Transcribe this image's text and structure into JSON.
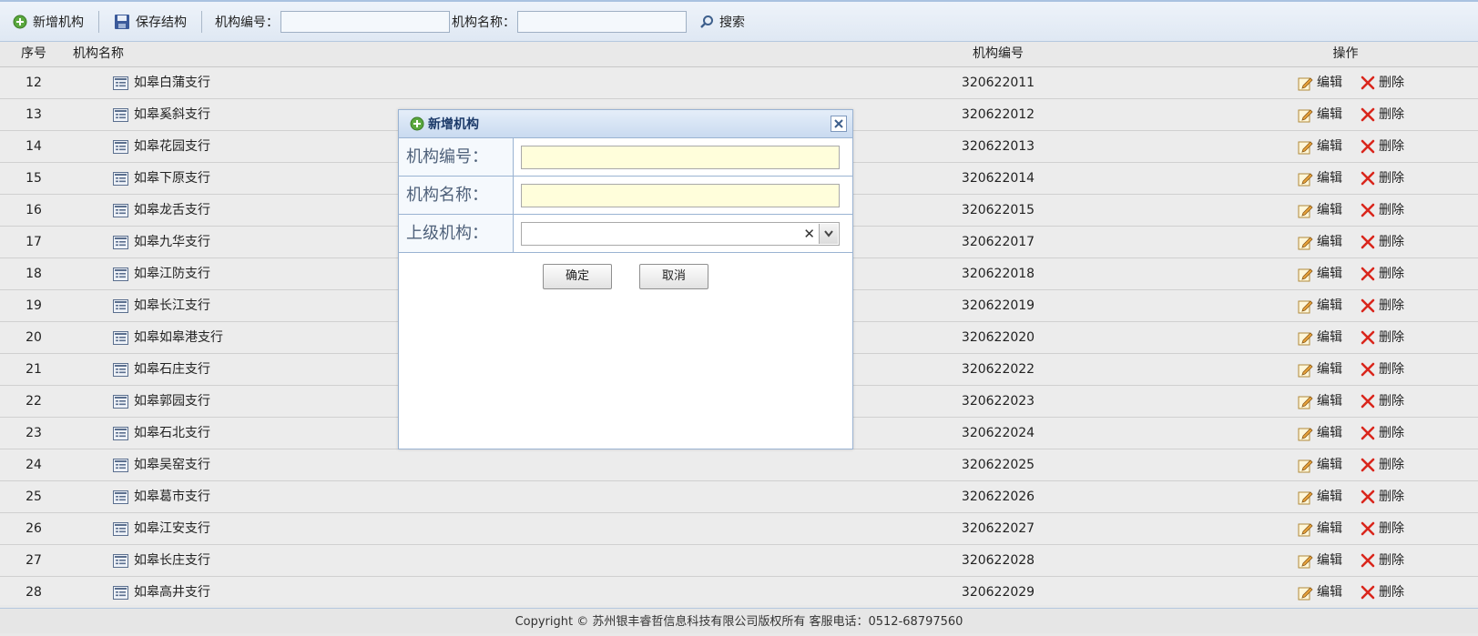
{
  "toolbar": {
    "add_label": "新增机构",
    "save_label": "保存结构",
    "code_label": "机构编号：",
    "name_label": "机构名称：",
    "code_value": "",
    "name_value": "",
    "search_label": "搜索"
  },
  "table": {
    "headers": {
      "index": "序号",
      "name": "机构名称",
      "code": "机构编号",
      "ops": "操作"
    },
    "edit_label": "编辑",
    "delete_label": "删除",
    "rows": [
      {
        "index": "12",
        "name": "如皋白蒲支行",
        "code": "320622011"
      },
      {
        "index": "13",
        "name": "如皋奚斜支行",
        "code": "320622012"
      },
      {
        "index": "14",
        "name": "如皋花园支行",
        "code": "320622013"
      },
      {
        "index": "15",
        "name": "如皋下原支行",
        "code": "320622014"
      },
      {
        "index": "16",
        "name": "如皋龙舌支行",
        "code": "320622015"
      },
      {
        "index": "17",
        "name": "如皋九华支行",
        "code": "320622017"
      },
      {
        "index": "18",
        "name": "如皋江防支行",
        "code": "320622018"
      },
      {
        "index": "19",
        "name": "如皋长江支行",
        "code": "320622019"
      },
      {
        "index": "20",
        "name": "如皋如皋港支行",
        "code": "320622020"
      },
      {
        "index": "21",
        "name": "如皋石庄支行",
        "code": "320622022"
      },
      {
        "index": "22",
        "name": "如皋郭园支行",
        "code": "320622023"
      },
      {
        "index": "23",
        "name": "如皋石北支行",
        "code": "320622024"
      },
      {
        "index": "24",
        "name": "如皋吴窑支行",
        "code": "320622025"
      },
      {
        "index": "25",
        "name": "如皋葛市支行",
        "code": "320622026"
      },
      {
        "index": "26",
        "name": "如皋江安支行",
        "code": "320622027"
      },
      {
        "index": "27",
        "name": "如皋长庄支行",
        "code": "320622028"
      },
      {
        "index": "28",
        "name": "如皋高井支行",
        "code": "320622029"
      }
    ]
  },
  "footer": {
    "text": "Copyright © 苏州银丰睿哲信息科技有限公司版权所有    客服电话：0512-68797560"
  },
  "dialog": {
    "title": "新增机构",
    "code_label": "机构编号：",
    "name_label": "机构名称：",
    "parent_label": "上级机构：",
    "code_value": "",
    "name_value": "",
    "parent_value": "",
    "ok_label": "确定",
    "cancel_label": "取消"
  },
  "colors": {
    "toolbar_bg": "#dfe8f3",
    "dialog_title": "#1c3a69",
    "input_bg": "#fffedb",
    "delete_red": "#d9261c"
  }
}
